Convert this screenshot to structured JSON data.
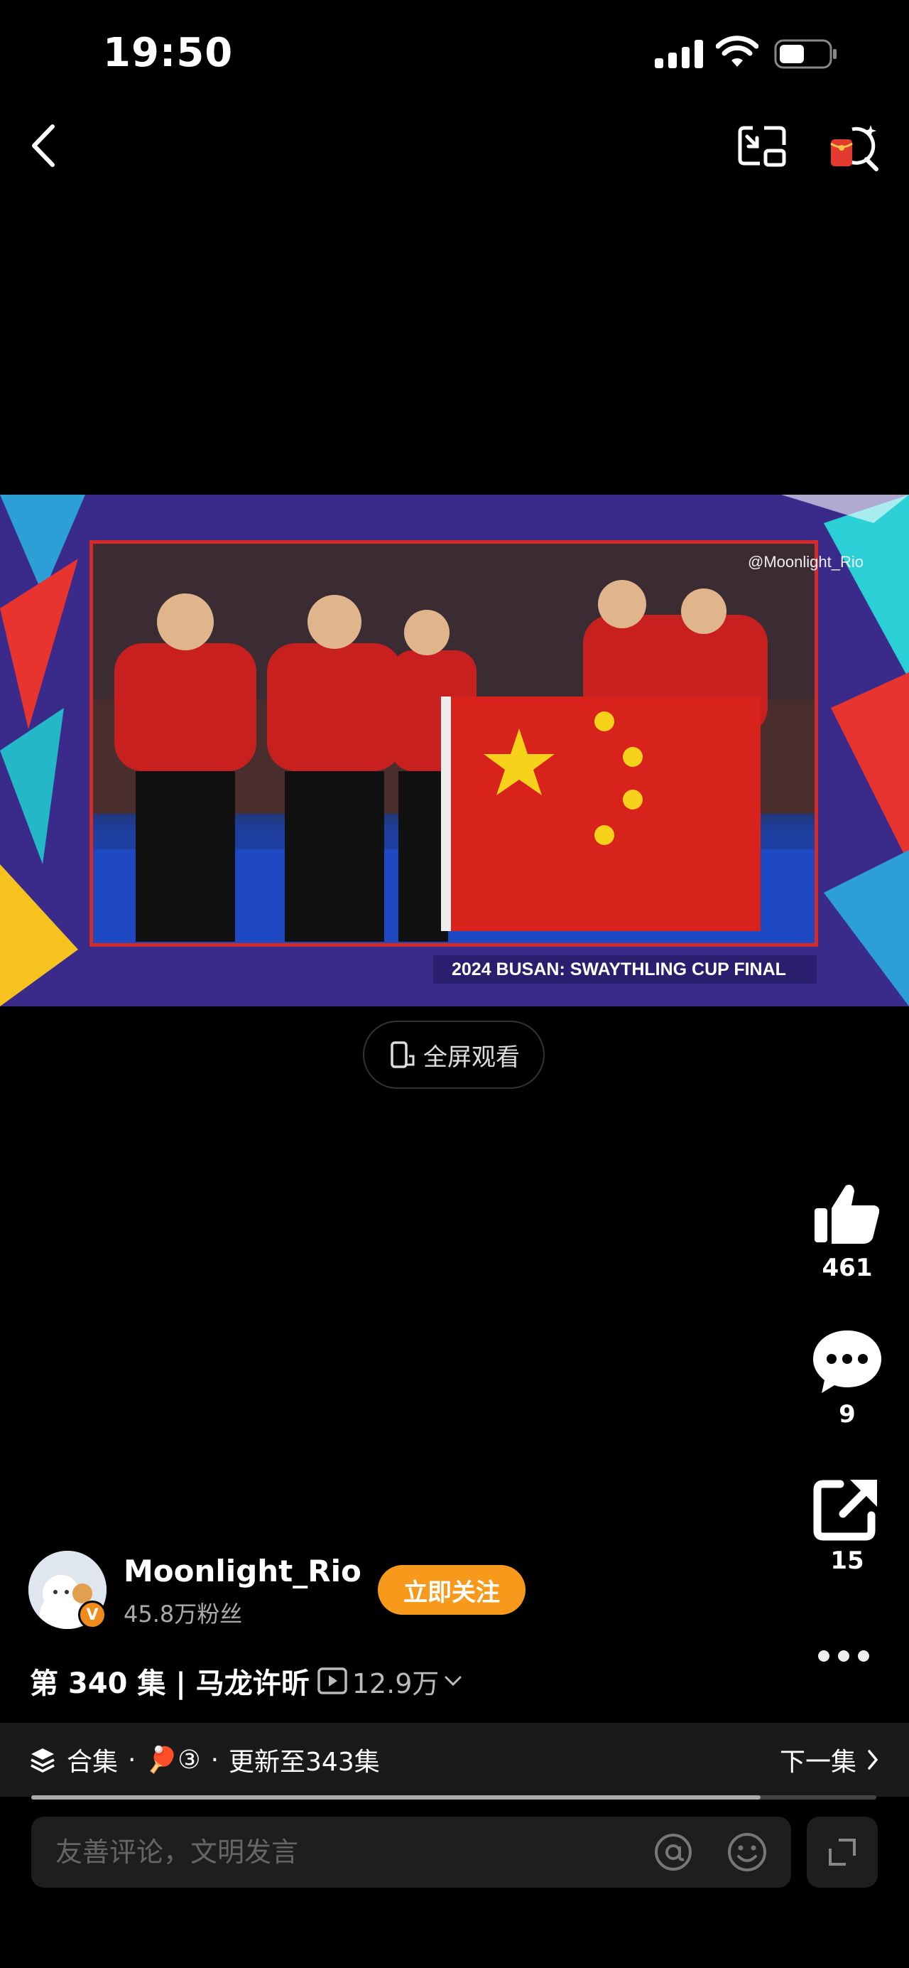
{
  "status_bar": {
    "time": "19:50"
  },
  "video": {
    "caption": "2024 BUSAN: SWAYTHLING CUP FINAL",
    "watermark": "@Moonlight_Rio"
  },
  "fullscreen_label": "全屏观看",
  "actions": {
    "likes": "461",
    "comments": "9",
    "shares": "15"
  },
  "author": {
    "name": "Moonlight_Rio",
    "fans": "45.8万粉丝",
    "follow_label": "立即关注"
  },
  "episode": {
    "title": "第 340 集 | 马龙许昕",
    "views": "12.9万"
  },
  "collection": {
    "label": "合集",
    "emoji": "🏓③",
    "update": "更新至343集",
    "next_label": "下一集",
    "progress": 0.97
  },
  "comment": {
    "placeholder": "友善评论，文明发言"
  },
  "colors": {
    "follow": "#f79a1b",
    "background": "#000000"
  }
}
